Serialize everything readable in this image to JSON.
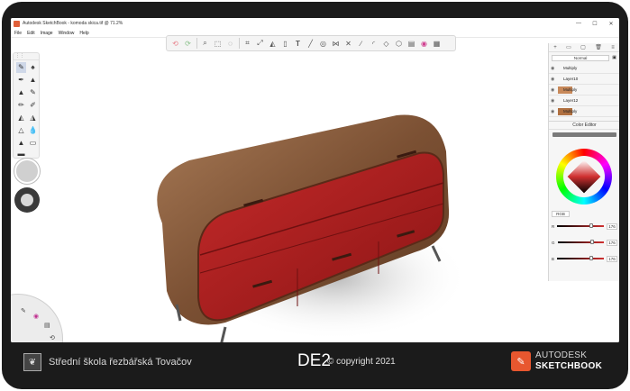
{
  "window": {
    "title": "Autodesk SketchBook - komoda skica.tif @ 71.2%",
    "controls": [
      "—",
      "☐",
      "✕"
    ]
  },
  "menu": [
    "File",
    "Edit",
    "Image",
    "Window",
    "Help"
  ],
  "toolbar": {
    "icons": [
      "undo-icon",
      "redo-icon",
      "zoom-icon",
      "select-icon",
      "lasso-icon",
      "crop-icon",
      "transform-icon",
      "fill-icon",
      "ruler-icon",
      "text-icon",
      "line-icon",
      "ellipse-icon",
      "symmetry-icon",
      "guides-icon",
      "stroke-icon",
      "curve-icon",
      "perspective-icon",
      "copic-icon",
      "layer-icon",
      "color-wheel-icon",
      "grid-icon"
    ]
  },
  "layers": {
    "blend_mode": "Normal",
    "items": [
      {
        "name": "Multiply",
        "thumb": "#ffffff"
      },
      {
        "name": "Layer10",
        "thumb": "#ffffff"
      },
      {
        "name": "Multiply",
        "thumb": "#c8895a"
      },
      {
        "name": "Layer12",
        "thumb": "#ffffff"
      },
      {
        "name": "Multiply",
        "thumb": "#b07040"
      }
    ]
  },
  "color_editor": {
    "title": "Color Editor",
    "mode": "RGB",
    "channels": [
      {
        "label": "R",
        "value": "176"
      },
      {
        "label": "G",
        "value": "176"
      },
      {
        "label": "B",
        "value": "176"
      }
    ]
  },
  "footer": {
    "school": "Střední škola řezbářská Tovačov",
    "code": "DE2",
    "copyright": "© copyright 2021",
    "brand_line1": "AUTODESK",
    "brand_line2": "SKETCHBOOK"
  },
  "colors": {
    "wood": "#8a5a3c",
    "lacquer": "#a81e1e",
    "accent": "#e8572f"
  }
}
